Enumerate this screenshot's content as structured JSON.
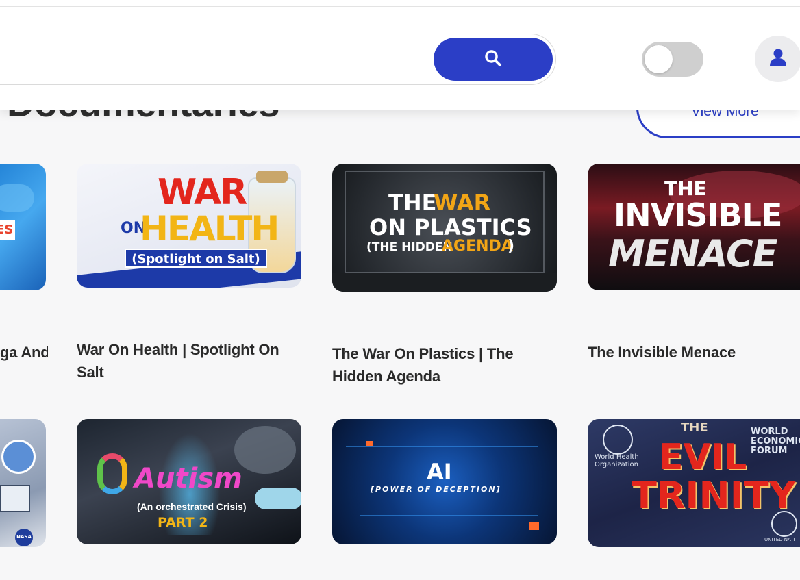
{
  "header": {
    "search_placeholder": "",
    "search_icon": "search-icon",
    "theme_toggle_state": "off",
    "profile_icon": "user-icon"
  },
  "section": {
    "title": "Documentaries",
    "view_more_label": "View More"
  },
  "cards": [
    {
      "title": "ga And",
      "thumb_text": "ES"
    },
    {
      "title": "War On Health | Spotlight On Salt",
      "thumb_line1": "WAR",
      "thumb_line2": "ON",
      "thumb_line3": "HEALTH",
      "thumb_line4": "(Spotlight on Salt)"
    },
    {
      "title": "The War On Plastics | The Hidden Agenda",
      "thumb_line1": "THE",
      "thumb_line2": "WAR",
      "thumb_line3": "ON PLASTICS",
      "thumb_line4": "(THE HIDDEN",
      "thumb_line5": "AGENDA",
      "thumb_line6": ")"
    },
    {
      "title": "The Invisible Menace",
      "thumb_line1": "THE",
      "thumb_line2": "INVISIBLE",
      "thumb_line3": "MENACE"
    },
    {
      "title": "",
      "thumb_text": "NASA"
    },
    {
      "title": "",
      "thumb_line1": "Autism",
      "thumb_line2": "(An orchestrated  Crisis)",
      "thumb_line3": "PART 2"
    },
    {
      "title": "",
      "thumb_line1": "AI",
      "thumb_line2": "[POWER OF DECEPTION]"
    },
    {
      "title": "",
      "thumb_line1": "THE",
      "thumb_line2": "EVIL",
      "thumb_line3": "TRINITY",
      "thumb_line4": "World Health Organization",
      "thumb_line5": "WORLD ECONOMIC FORUM",
      "thumb_line6": "UNITED NATI"
    }
  ],
  "colors": {
    "accent": "#2b3ec6",
    "background": "#f7f7f8"
  }
}
